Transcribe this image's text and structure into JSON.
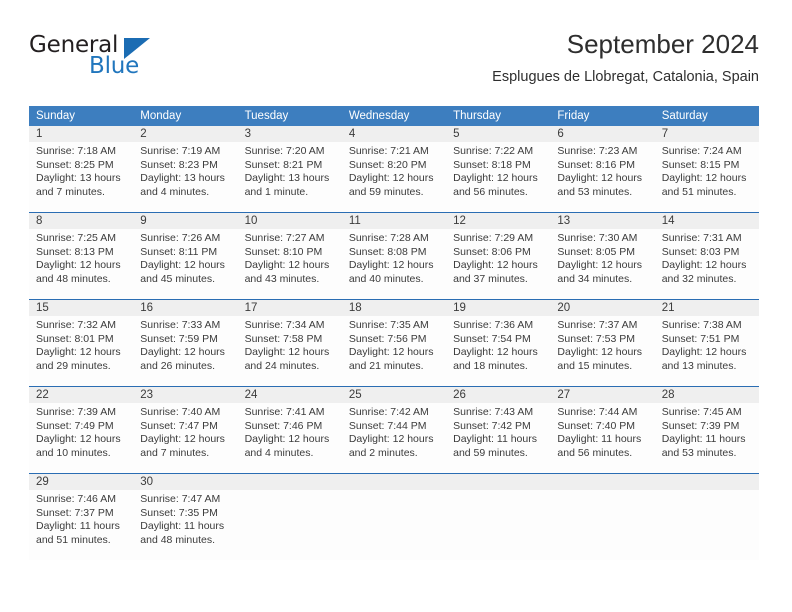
{
  "brand": {
    "name_part1": "General",
    "name_part2": "Blue",
    "triangle_color": "#1b6cb3",
    "text_color": "#231f20",
    "blue_color": "#2176bd"
  },
  "header": {
    "title": "September 2024",
    "subtitle": "Esplugues de Llobregat, Catalonia, Spain"
  },
  "theme": {
    "header_bg": "#3d7ebf",
    "header_text": "#ffffff",
    "daynum_band_bg": "#efefef",
    "row_divider": "#2a6db3",
    "cell_bg": "#fdfdfd",
    "body_text": "#3b3b3b"
  },
  "weekdays": [
    "Sunday",
    "Monday",
    "Tuesday",
    "Wednesday",
    "Thursday",
    "Friday",
    "Saturday"
  ],
  "weeks": [
    {
      "days": [
        {
          "num": "1",
          "lines": [
            "Sunrise: 7:18 AM",
            "Sunset: 8:25 PM",
            "Daylight: 13 hours",
            "and 7 minutes."
          ]
        },
        {
          "num": "2",
          "lines": [
            "Sunrise: 7:19 AM",
            "Sunset: 8:23 PM",
            "Daylight: 13 hours",
            "and 4 minutes."
          ]
        },
        {
          "num": "3",
          "lines": [
            "Sunrise: 7:20 AM",
            "Sunset: 8:21 PM",
            "Daylight: 13 hours",
            "and 1 minute."
          ]
        },
        {
          "num": "4",
          "lines": [
            "Sunrise: 7:21 AM",
            "Sunset: 8:20 PM",
            "Daylight: 12 hours",
            "and 59 minutes."
          ]
        },
        {
          "num": "5",
          "lines": [
            "Sunrise: 7:22 AM",
            "Sunset: 8:18 PM",
            "Daylight: 12 hours",
            "and 56 minutes."
          ]
        },
        {
          "num": "6",
          "lines": [
            "Sunrise: 7:23 AM",
            "Sunset: 8:16 PM",
            "Daylight: 12 hours",
            "and 53 minutes."
          ]
        },
        {
          "num": "7",
          "lines": [
            "Sunrise: 7:24 AM",
            "Sunset: 8:15 PM",
            "Daylight: 12 hours",
            "and 51 minutes."
          ]
        }
      ]
    },
    {
      "days": [
        {
          "num": "8",
          "lines": [
            "Sunrise: 7:25 AM",
            "Sunset: 8:13 PM",
            "Daylight: 12 hours",
            "and 48 minutes."
          ]
        },
        {
          "num": "9",
          "lines": [
            "Sunrise: 7:26 AM",
            "Sunset: 8:11 PM",
            "Daylight: 12 hours",
            "and 45 minutes."
          ]
        },
        {
          "num": "10",
          "lines": [
            "Sunrise: 7:27 AM",
            "Sunset: 8:10 PM",
            "Daylight: 12 hours",
            "and 43 minutes."
          ]
        },
        {
          "num": "11",
          "lines": [
            "Sunrise: 7:28 AM",
            "Sunset: 8:08 PM",
            "Daylight: 12 hours",
            "and 40 minutes."
          ]
        },
        {
          "num": "12",
          "lines": [
            "Sunrise: 7:29 AM",
            "Sunset: 8:06 PM",
            "Daylight: 12 hours",
            "and 37 minutes."
          ]
        },
        {
          "num": "13",
          "lines": [
            "Sunrise: 7:30 AM",
            "Sunset: 8:05 PM",
            "Daylight: 12 hours",
            "and 34 minutes."
          ]
        },
        {
          "num": "14",
          "lines": [
            "Sunrise: 7:31 AM",
            "Sunset: 8:03 PM",
            "Daylight: 12 hours",
            "and 32 minutes."
          ]
        }
      ]
    },
    {
      "days": [
        {
          "num": "15",
          "lines": [
            "Sunrise: 7:32 AM",
            "Sunset: 8:01 PM",
            "Daylight: 12 hours",
            "and 29 minutes."
          ]
        },
        {
          "num": "16",
          "lines": [
            "Sunrise: 7:33 AM",
            "Sunset: 7:59 PM",
            "Daylight: 12 hours",
            "and 26 minutes."
          ]
        },
        {
          "num": "17",
          "lines": [
            "Sunrise: 7:34 AM",
            "Sunset: 7:58 PM",
            "Daylight: 12 hours",
            "and 24 minutes."
          ]
        },
        {
          "num": "18",
          "lines": [
            "Sunrise: 7:35 AM",
            "Sunset: 7:56 PM",
            "Daylight: 12 hours",
            "and 21 minutes."
          ]
        },
        {
          "num": "19",
          "lines": [
            "Sunrise: 7:36 AM",
            "Sunset: 7:54 PM",
            "Daylight: 12 hours",
            "and 18 minutes."
          ]
        },
        {
          "num": "20",
          "lines": [
            "Sunrise: 7:37 AM",
            "Sunset: 7:53 PM",
            "Daylight: 12 hours",
            "and 15 minutes."
          ]
        },
        {
          "num": "21",
          "lines": [
            "Sunrise: 7:38 AM",
            "Sunset: 7:51 PM",
            "Daylight: 12 hours",
            "and 13 minutes."
          ]
        }
      ]
    },
    {
      "days": [
        {
          "num": "22",
          "lines": [
            "Sunrise: 7:39 AM",
            "Sunset: 7:49 PM",
            "Daylight: 12 hours",
            "and 10 minutes."
          ]
        },
        {
          "num": "23",
          "lines": [
            "Sunrise: 7:40 AM",
            "Sunset: 7:47 PM",
            "Daylight: 12 hours",
            "and 7 minutes."
          ]
        },
        {
          "num": "24",
          "lines": [
            "Sunrise: 7:41 AM",
            "Sunset: 7:46 PM",
            "Daylight: 12 hours",
            "and 4 minutes."
          ]
        },
        {
          "num": "25",
          "lines": [
            "Sunrise: 7:42 AM",
            "Sunset: 7:44 PM",
            "Daylight: 12 hours",
            "and 2 minutes."
          ]
        },
        {
          "num": "26",
          "lines": [
            "Sunrise: 7:43 AM",
            "Sunset: 7:42 PM",
            "Daylight: 11 hours",
            "and 59 minutes."
          ]
        },
        {
          "num": "27",
          "lines": [
            "Sunrise: 7:44 AM",
            "Sunset: 7:40 PM",
            "Daylight: 11 hours",
            "and 56 minutes."
          ]
        },
        {
          "num": "28",
          "lines": [
            "Sunrise: 7:45 AM",
            "Sunset: 7:39 PM",
            "Daylight: 11 hours",
            "and 53 minutes."
          ]
        }
      ]
    },
    {
      "days": [
        {
          "num": "29",
          "lines": [
            "Sunrise: 7:46 AM",
            "Sunset: 7:37 PM",
            "Daylight: 11 hours",
            "and 51 minutes."
          ]
        },
        {
          "num": "30",
          "lines": [
            "Sunrise: 7:47 AM",
            "Sunset: 7:35 PM",
            "Daylight: 11 hours",
            "and 48 minutes."
          ]
        },
        {
          "num": "",
          "lines": []
        },
        {
          "num": "",
          "lines": []
        },
        {
          "num": "",
          "lines": []
        },
        {
          "num": "",
          "lines": []
        },
        {
          "num": "",
          "lines": []
        }
      ]
    }
  ]
}
